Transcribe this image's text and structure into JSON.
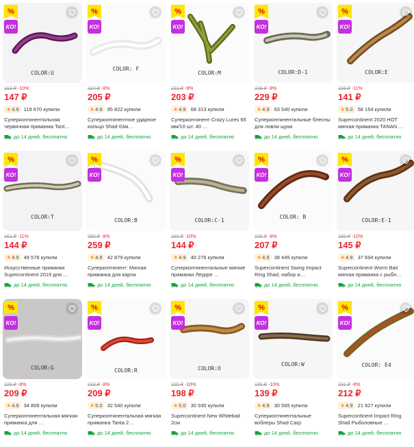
{
  "badges": {
    "discount": "%",
    "ko": "KO!"
  },
  "colors": {
    "price": "#f0242c",
    "delivery": "#10a33b",
    "rating_star": "#ff9e0d",
    "badge_yellow": "#ffe600",
    "badge_purple": "#c42fe0"
  },
  "products": [
    {
      "color_label": "COLOR:U",
      "old_price": "163 ₽",
      "discount": "-10%",
      "price": "147 ₽",
      "rating": "4.9",
      "bought": "119 670 купили",
      "title": "Суперконтинентальная червячная приманка Tant…",
      "delivery": "до 14 дней, бесплатно",
      "icon": "purple-worm"
    },
    {
      "color_label": "COLOR: F",
      "old_price": "224 ₽",
      "discount": "-8%",
      "price": "205 ₽",
      "rating": "4.9",
      "bought": "95 822 купили",
      "title": "Суперконтинентное ударное кольцо Shad 63м…",
      "delivery": "до 14 дней, бесплатно",
      "icon": "white-shad"
    },
    {
      "color_label": "COLOR:M",
      "old_price": "222 ₽",
      "discount": "-9%",
      "price": "203 ₽",
      "rating": "4.9",
      "bought": "68 313 купили",
      "title": "Суперконтинент Crazy Lures 65 мм/10 шт. 40 …",
      "delivery": "до 14 дней, бесплатно",
      "icon": "green-craw"
    },
    {
      "color_label": "COLOR:D-1",
      "old_price": "248 ₽",
      "discount": "-8%",
      "price": "229 ₽",
      "rating": "4.9",
      "bought": "63 540 купили",
      "title": "Суперконтинентальные блесны для ловли щуки",
      "delivery": "до 14 дней, бесплатно",
      "icon": "olive-shad"
    },
    {
      "color_label": "COLOR:E",
      "old_price": "159 ₽",
      "discount": "-11%",
      "price": "141 ₽",
      "rating": "5.0",
      "bought": "58 154 купили",
      "title": "Supercontinent 2020 HOT мягкая приманка TANAN …",
      "delivery": "до 14 дней, бесплатно",
      "icon": "brown-ribbed"
    },
    {
      "color_label": "COLOR:T",
      "old_price": "161 ₽",
      "discount": "-11%",
      "price": "144 ₽",
      "rating": "4.9",
      "bought": "49 578 купили",
      "title": "Искусственные приманки Supercontinent 2019 для …",
      "delivery": "до 14 дней, бесплатно",
      "icon": "green-shad"
    },
    {
      "color_label": "COLOR:B",
      "old_price": "280 ₽",
      "discount": "-8%",
      "price": "259 ₽",
      "rating": "4.9",
      "bought": "42 879 купили",
      "title": "Суперконтинент: Мягкая приманка для карпа",
      "delivery": "до 14 дней, бесплатно",
      "icon": "white-paddle"
    },
    {
      "color_label": "COLOR:C-1",
      "old_price": "160 ₽",
      "discount": "-10%",
      "price": "144 ₽",
      "rating": "4.9",
      "bought": "40 276 купили",
      "title": "Суперконтинентальные мягкие приманки Леурре …",
      "delivery": "до 14 дней, бесплатно",
      "icon": "speckled-shad"
    },
    {
      "color_label": "COLOR: B",
      "old_price": "226 ₽",
      "discount": "-8%",
      "price": "207 ₽",
      "rating": "4.9",
      "bought": "38 445 купили",
      "title": "Supercontinent Swing Impact Ring Shad, набор и…",
      "delivery": "до 14 дней, бесплатно",
      "icon": "rust-ribbed"
    },
    {
      "color_label": "COLOR:E-1",
      "old_price": "160 ₽",
      "discount": "-10%",
      "price": "145 ₽",
      "rating": "4.9",
      "bought": "37 694 купили",
      "title": "Supercontinent Worm Bait мягкая приманка с рыбн…",
      "delivery": "до 14 дней, бесплатно",
      "icon": "brown-ribbed-2"
    },
    {
      "color_label": "COLOR:G",
      "old_price": "226 ₽",
      "discount": "-8%",
      "price": "209 ₽",
      "rating": "4.9",
      "bought": "34 809 купили",
      "title": "Суперконтинентальная мягкая приманка для …",
      "delivery": "до 14 дней, бесплатно",
      "icon": "white-worm"
    },
    {
      "color_label": "COLOR:R",
      "old_price": "233 ₽",
      "discount": "-8%",
      "price": "209 ₽",
      "rating": "5.0",
      "bought": "32 540 купили",
      "title": "Суперконтинентальная мягкая приманка Tanta 2…",
      "delivery": "до 14 дней, бесплатно",
      "icon": "red-worm"
    },
    {
      "color_label": "COLOR:O",
      "old_price": "220 ₽",
      "discount": "-10%",
      "price": "198 ₽",
      "rating": "5.0",
      "bought": "30 930 купили",
      "title": "Supercontinent New Whitebait 2см",
      "delivery": "до 14 дней, бесплатно",
      "icon": "amber-paddle"
    },
    {
      "color_label": "COLOR:W",
      "old_price": "155 ₽",
      "discount": "-10%",
      "price": "139 ₽",
      "rating": "4.9",
      "bought": "30 565 купили",
      "title": "Суперконтинентальные воблеры Shad Carp",
      "delivery": "до 14 дней, бесплатно",
      "icon": "brown-ribbed-3"
    },
    {
      "color_label": "COLOR: E4",
      "old_price": "231 ₽",
      "discount": "-8%",
      "price": "212 ₽",
      "rating": "4.9",
      "bought": "21 927 купили",
      "title": "Supercontinent Impact Ring Shad Рыболовные …",
      "delivery": "до 14 дней, бесплатно",
      "icon": "green-ribbed"
    }
  ]
}
